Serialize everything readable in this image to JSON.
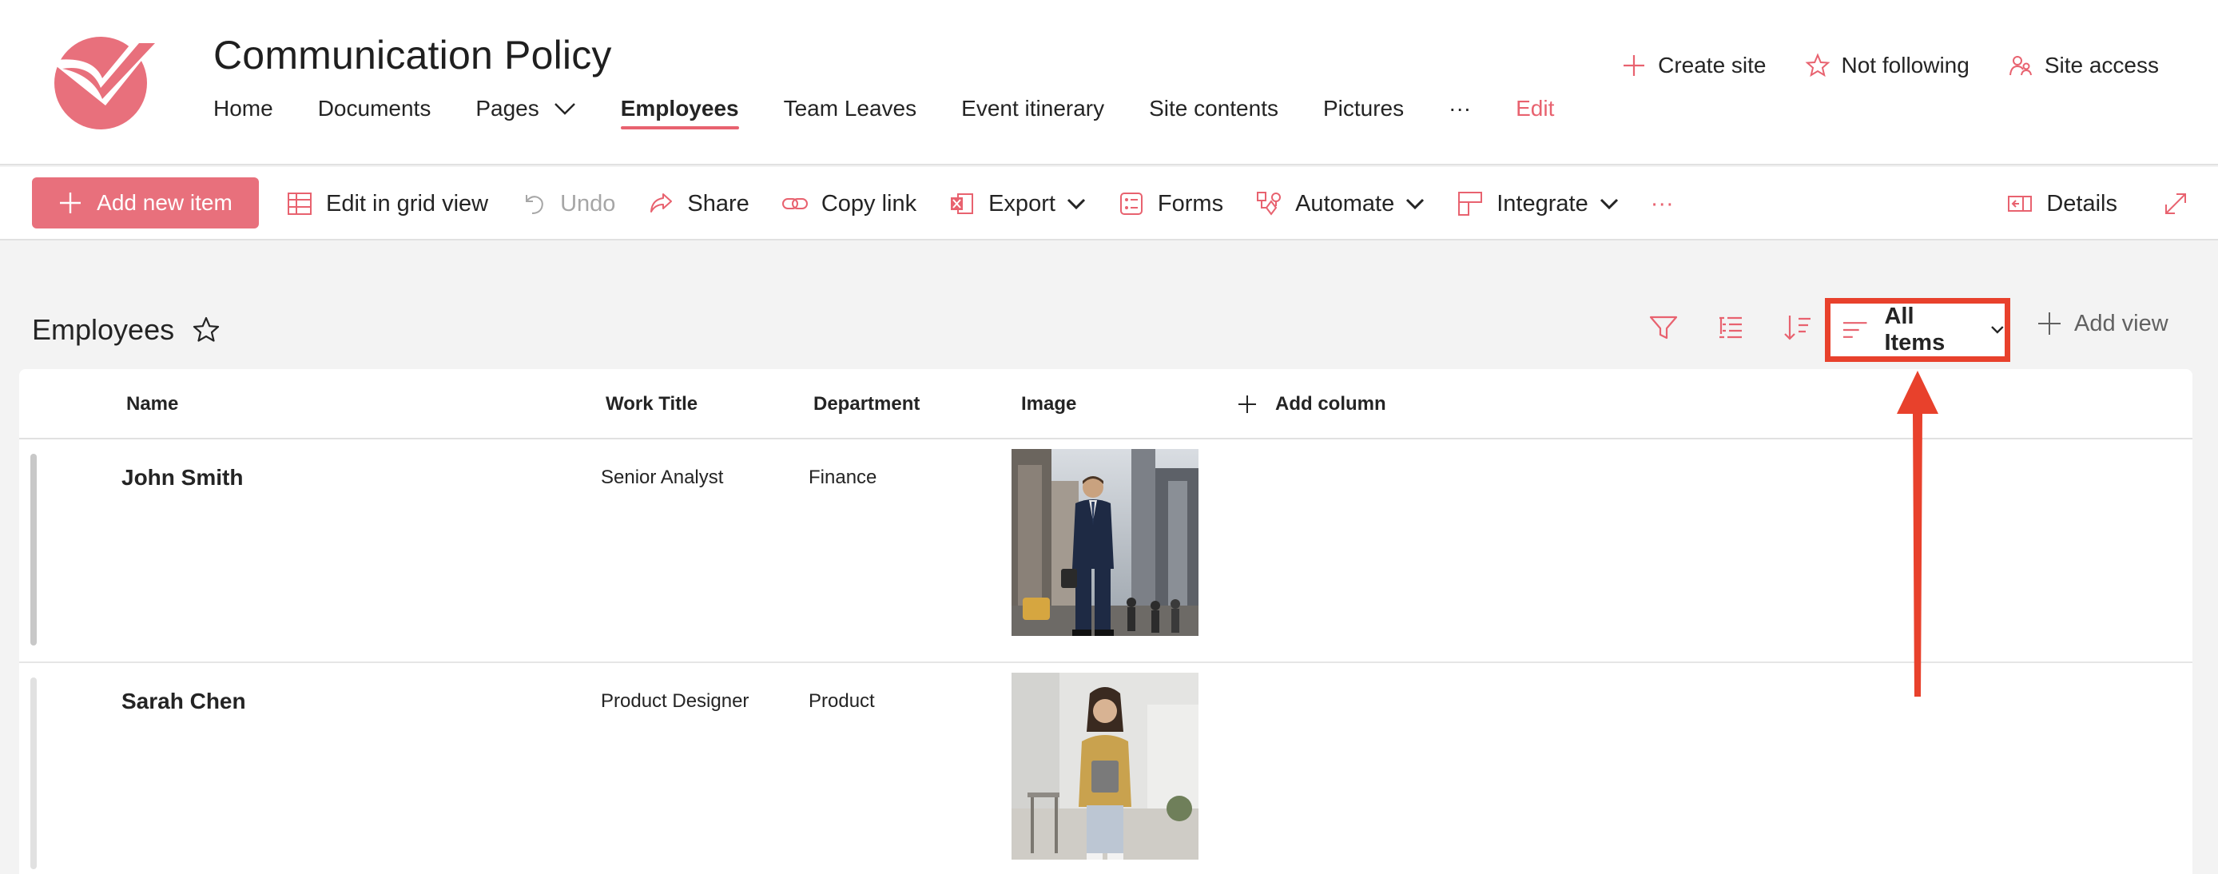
{
  "site": {
    "title": "Communication Policy",
    "nav": [
      {
        "label": "Home"
      },
      {
        "label": "Documents"
      },
      {
        "label": "Pages"
      },
      {
        "label": "Employees"
      },
      {
        "label": "Team Leaves"
      },
      {
        "label": "Event itinerary"
      },
      {
        "label": "Site contents"
      },
      {
        "label": "Pictures"
      },
      {
        "label": "···"
      },
      {
        "label": "Edit"
      }
    ],
    "actions": {
      "create_site": "Create site",
      "not_following": "Not following",
      "site_access": "Site access"
    },
    "accent_color": "#e8626f"
  },
  "command_bar": {
    "add_new_item": "Add new item",
    "edit_grid": "Edit in grid view",
    "undo": "Undo",
    "share": "Share",
    "copy_link": "Copy link",
    "export": "Export",
    "forms": "Forms",
    "automate": "Automate",
    "integrate": "Integrate",
    "more": "···",
    "details": "Details"
  },
  "list": {
    "title": "Employees",
    "current_view": "All Items",
    "add_view": "Add view",
    "columns": {
      "name": "Name",
      "work_title": "Work Title",
      "department": "Department",
      "image": "Image",
      "add_column": "Add column"
    },
    "rows": [
      {
        "name": "John Smith",
        "work_title": "Senior Analyst",
        "department": "Finance"
      },
      {
        "name": "Sarah Chen",
        "work_title": "Product Designer",
        "department": "Product"
      }
    ]
  },
  "annotation_color": "#e8412c"
}
